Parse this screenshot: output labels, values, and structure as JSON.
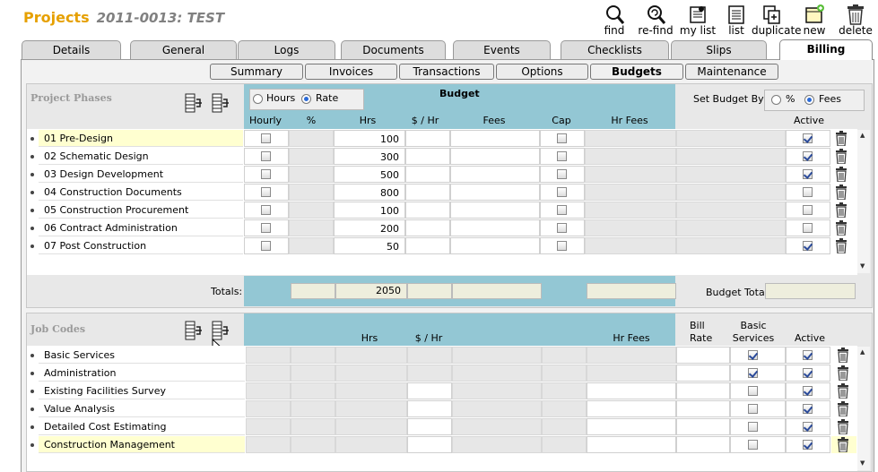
{
  "header": {
    "app": "Projects",
    "record": "2011-0013: TEST"
  },
  "toolbar": [
    {
      "label": "find",
      "icon": "find-icon"
    },
    {
      "label": "re-find",
      "icon": "refind-icon"
    },
    {
      "label": "my list",
      "icon": "my-list-icon"
    },
    {
      "label": "list",
      "icon": "list-icon"
    },
    {
      "label": "duplicate",
      "icon": "duplicate-icon"
    },
    {
      "label": "new",
      "icon": "new-icon"
    },
    {
      "label": "delete",
      "icon": "delete-icon"
    }
  ],
  "tabs": [
    "Details",
    "General",
    "Logs",
    "Documents",
    "Events",
    "Checklists",
    "Slips",
    "Billing"
  ],
  "active_tab": "Billing",
  "subtabs": [
    "Summary",
    "Invoices",
    "Transactions",
    "Options",
    "Budgets",
    "Maintenance"
  ],
  "active_subtab": "Budgets",
  "phases": {
    "title": "Project Phases",
    "budget_label": "Budget",
    "mode_options": [
      "Hours",
      "Rate"
    ],
    "mode_selected": "Rate",
    "set_budget_by_label": "Set Budget By",
    "set_budget_options": [
      "%",
      "Fees"
    ],
    "set_budget_selected": "Fees",
    "columns": [
      "Hourly",
      "%",
      "Hrs",
      "$ / Hr",
      "Fees",
      "Cap",
      "Hr Fees"
    ],
    "active_label": "Active",
    "rows": [
      {
        "name": "01 Pre-Design",
        "hrs": "100",
        "active": true
      },
      {
        "name": "02 Schematic Design",
        "hrs": "300",
        "active": true
      },
      {
        "name": "03 Design Development",
        "hrs": "500",
        "active": true
      },
      {
        "name": "04 Construction Documents",
        "hrs": "800",
        "active": false
      },
      {
        "name": "05 Construction Procurement",
        "hrs": "100",
        "active": false
      },
      {
        "name": "06 Contract Administration",
        "hrs": "200",
        "active": false
      },
      {
        "name": "07 Post Construction",
        "hrs": "50",
        "active": true
      }
    ],
    "totals_label": "Totals:",
    "total_hrs": "2050",
    "budget_total_label": "Budget Total:"
  },
  "jobcodes": {
    "title": "Job Codes",
    "columns": [
      "Hrs",
      "$ / Hr",
      "Hr Fees"
    ],
    "bill_rate_label": [
      "Bill",
      "Rate"
    ],
    "basic_services_label": [
      "Basic",
      "Services"
    ],
    "active_label": "Active",
    "rows": [
      {
        "name": "Basic Services",
        "basic": true,
        "active": true
      },
      {
        "name": "Administration",
        "basic": true,
        "active": true
      },
      {
        "name": "Existing Facilities Survey",
        "basic": false,
        "active": true
      },
      {
        "name": "Value Analysis",
        "basic": false,
        "active": true
      },
      {
        "name": "Detailed Cost Estimating",
        "basic": false,
        "active": true
      },
      {
        "name": "Construction Management",
        "basic": false,
        "active": true
      }
    ]
  },
  "colors": {
    "title_orange": "#e6a000",
    "header_blue": "#93c7d4",
    "highlight_yellow": "#ffffd0"
  }
}
